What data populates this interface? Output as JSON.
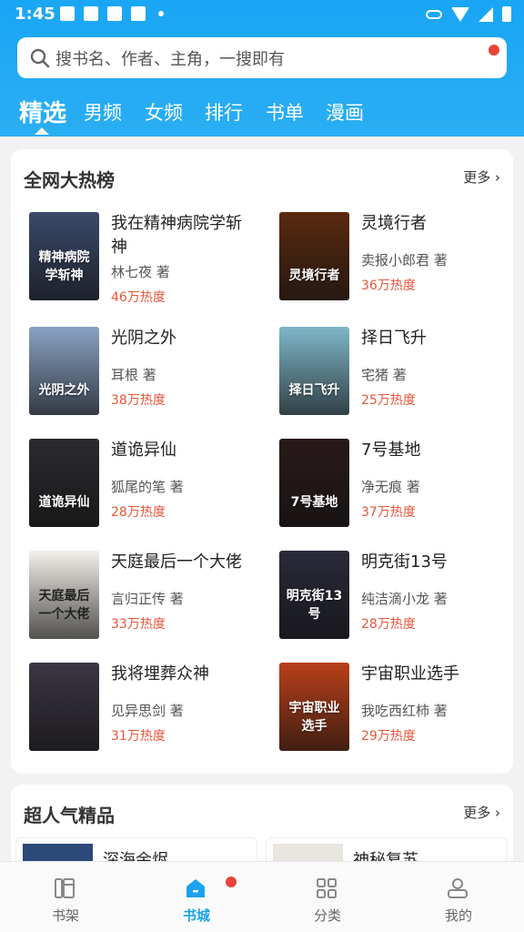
{
  "status_bar": {
    "time": "1:45"
  },
  "search": {
    "placeholder": "搜书名、作者、主角，一搜即有"
  },
  "tabs": [
    {
      "label": "精选",
      "active": true
    },
    {
      "label": "男频"
    },
    {
      "label": "女频"
    },
    {
      "label": "排行"
    },
    {
      "label": "书单"
    },
    {
      "label": "漫画"
    }
  ],
  "hot_list": {
    "title": "全网大热榜",
    "more": "更多",
    "books": [
      {
        "title": "我在精神病院学斩神",
        "author": "林七夜 著",
        "heat": "46万热度",
        "cover_text": "精神病院学斩神",
        "cover_color": "#3a4a6a"
      },
      {
        "title": "灵境行者",
        "author": "卖报小郎君 著",
        "heat": "36万热度",
        "cover_text": "灵境行者",
        "cover_color": "#5a2a10"
      },
      {
        "title": "光阴之外",
        "author": "耳根 著",
        "heat": "38万热度",
        "cover_text": "光阴之外",
        "cover_color": "#8aa3c4"
      },
      {
        "title": "择日飞升",
        "author": "宅猪 著",
        "heat": "25万热度",
        "cover_text": "择日飞升",
        "cover_color": "#7fb7c9"
      },
      {
        "title": "道诡异仙",
        "author": "狐尾的笔 著",
        "heat": "28万热度",
        "cover_text": "道诡异仙",
        "cover_color": "#2b2b2f"
      },
      {
        "title": "7号基地",
        "author": "净无痕 著",
        "heat": "37万热度",
        "cover_text": "7号基地",
        "cover_color": "#2a1a1a"
      },
      {
        "title": "天庭最后一个大佬",
        "author": "言归正传 著",
        "heat": "33万热度",
        "cover_text": "天庭最后一个大佬",
        "cover_color": "#f4f0ea"
      },
      {
        "title": "明克街13号",
        "author": "纯洁滴小龙 著",
        "heat": "28万热度",
        "cover_text": "明克街13号",
        "cover_color": "#2a2a3a"
      },
      {
        "title": "我将埋葬众神",
        "author": "见异思剑 著",
        "heat": "31万热度",
        "cover_text": "",
        "cover_color": "#3b3642"
      },
      {
        "title": "宇宙职业选手",
        "author": "我吃西红柿 著",
        "heat": "29万热度",
        "cover_text": "宇宙职业选手",
        "cover_color": "#b8401a"
      }
    ]
  },
  "featured": {
    "title": "超人气精品",
    "more": "更多",
    "books": [
      {
        "title": "深海余烬"
      },
      {
        "title": "神秘复苏"
      }
    ]
  },
  "nav": [
    {
      "label": "书架",
      "icon": "bookshelf-icon"
    },
    {
      "label": "书城",
      "icon": "store-icon",
      "active": true
    },
    {
      "label": "分类",
      "icon": "category-icon"
    },
    {
      "label": "我的",
      "icon": "profile-icon"
    }
  ],
  "colors": {
    "accent": "#1aa3f0",
    "heat": "#e8553a",
    "badge": "#e8443a"
  }
}
